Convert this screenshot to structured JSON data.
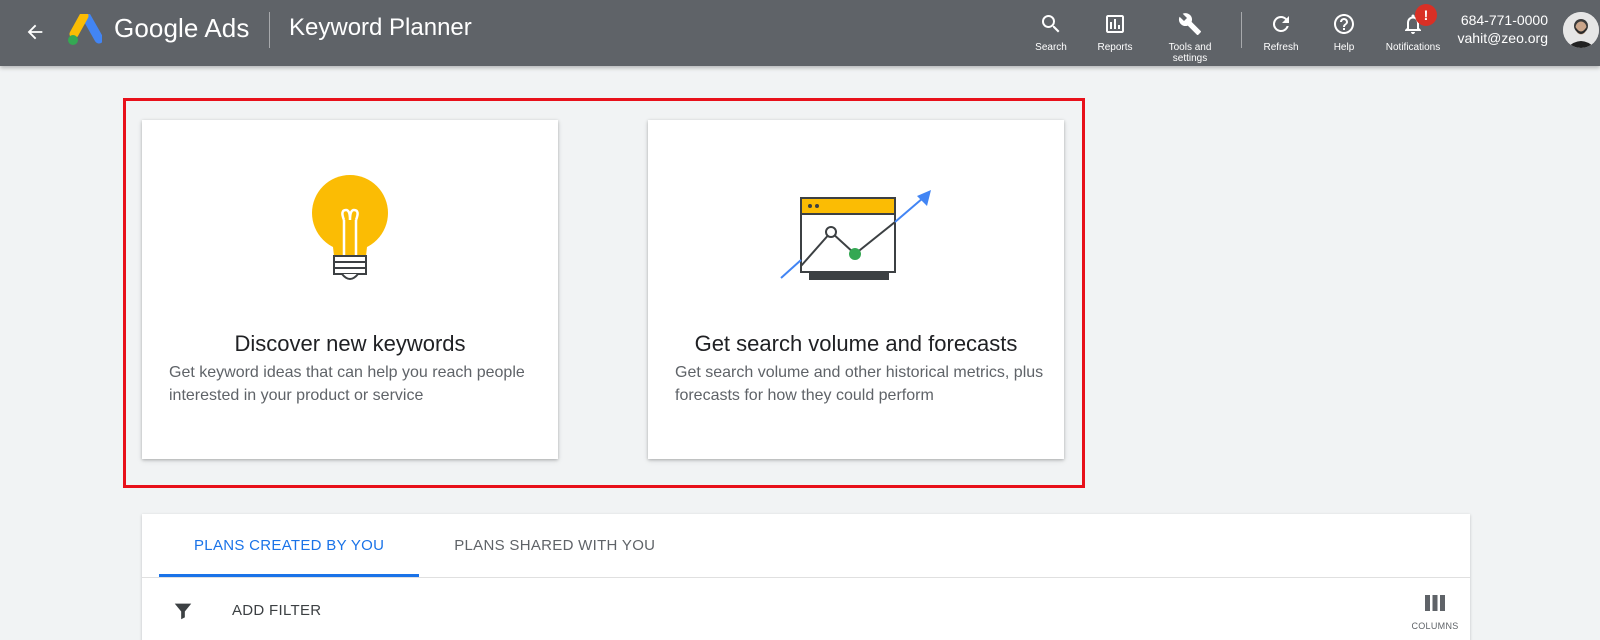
{
  "header": {
    "brand": "Google Ads",
    "product": "Keyword Planner",
    "tools": {
      "search": "Search",
      "reports": "Reports",
      "tools_line1": "Tools and",
      "tools_line2": "settings",
      "refresh": "Refresh",
      "help": "Help",
      "notifications": "Notifications",
      "notification_badge": "!"
    },
    "account": {
      "phone": "684-771-0000",
      "email": "vahit@zeo.org"
    }
  },
  "cards": [
    {
      "title": "Discover new keywords",
      "description": "Get keyword ideas that can help you reach people interested in your product or service",
      "icon": "lightbulb-icon"
    },
    {
      "title": "Get search volume and forecasts",
      "description": "Get search volume and other historical metrics, plus forecasts for how they could perform",
      "icon": "forecast-chart-icon"
    }
  ],
  "plans": {
    "tabs": [
      "PLANS CREATED BY YOU",
      "PLANS SHARED WITH YOU"
    ],
    "active_tab": 0,
    "add_filter": "ADD FILTER",
    "columns": "COLUMNS"
  },
  "colors": {
    "topbar": "#5f6368",
    "highlight": "#e8101a",
    "accent": "#1a73e8",
    "bulb": "#fbbc04",
    "point": "#34a853"
  }
}
